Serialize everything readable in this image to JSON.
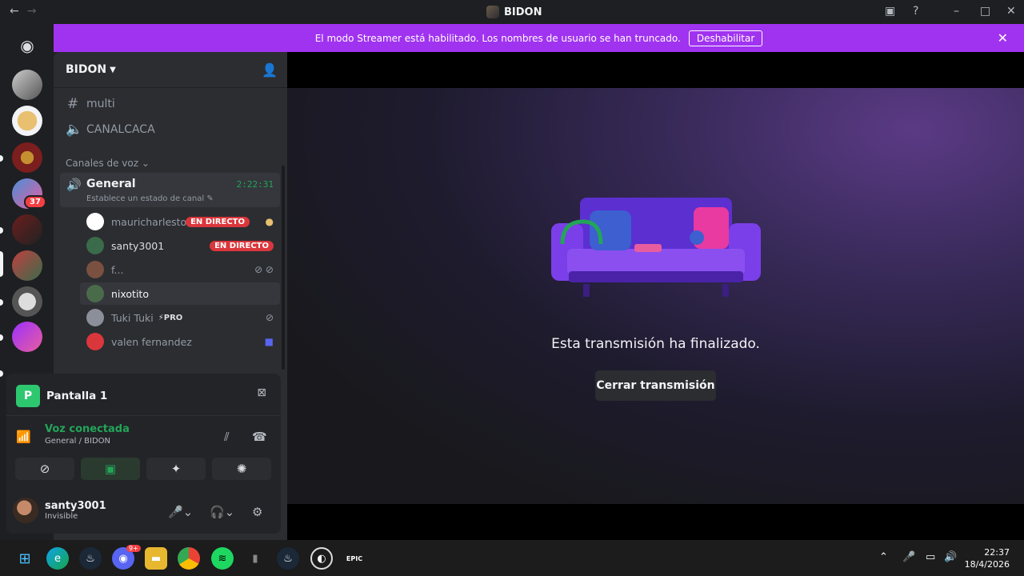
{
  "window": {
    "title": "BIDON",
    "back": "←",
    "forward": "→"
  },
  "banner": {
    "text": "El modo Streamer está habilitado. Los nombres de usuario se han truncado.",
    "button": "Deshabilitar"
  },
  "server_badge": "37",
  "guild": {
    "name": "BIDON"
  },
  "channels": [
    {
      "type": "text",
      "name": "multi"
    },
    {
      "type": "voice",
      "name": "CANALCACA"
    }
  ],
  "voice_category": "Canales de voz",
  "voice_channel": {
    "name": "General",
    "timer": "2:22:31",
    "status": "Establece un estado de canal"
  },
  "voice_users": [
    {
      "name": "mauricharleston",
      "live": "EN DIRECTO",
      "avatar": "#ffffff"
    },
    {
      "name": "santy3001",
      "live": "EN DIRECTO",
      "avatar": "#3a6b4a"
    },
    {
      "name": "f...",
      "live": "",
      "avatar": "#7a5040"
    },
    {
      "name": "nixotito",
      "live": "",
      "avatar": "#4a6b4a"
    },
    {
      "name": "Tuki Tuki",
      "live": "",
      "pro": "PRO",
      "avatar": "#8a8f99"
    },
    {
      "name": "valen fernandez",
      "live": "",
      "avatar": "#da373c"
    }
  ],
  "stream_panel": {
    "label": "Pantalla 1"
  },
  "voice_status": {
    "title": "Voz conectada",
    "subtitle": "General / BIDON"
  },
  "user_panel": {
    "name": "santy3001",
    "status": "Invisible"
  },
  "stage": {
    "message": "Esta transmisión ha finalizado.",
    "close_button": "Cerrar transmisión"
  },
  "taskbar": {
    "time": "22:37",
    "date": "18/4/2026",
    "discord_badge": "9+"
  },
  "colors": {
    "accent": "#a033f0",
    "green": "#23a559",
    "live": "#da373c"
  }
}
